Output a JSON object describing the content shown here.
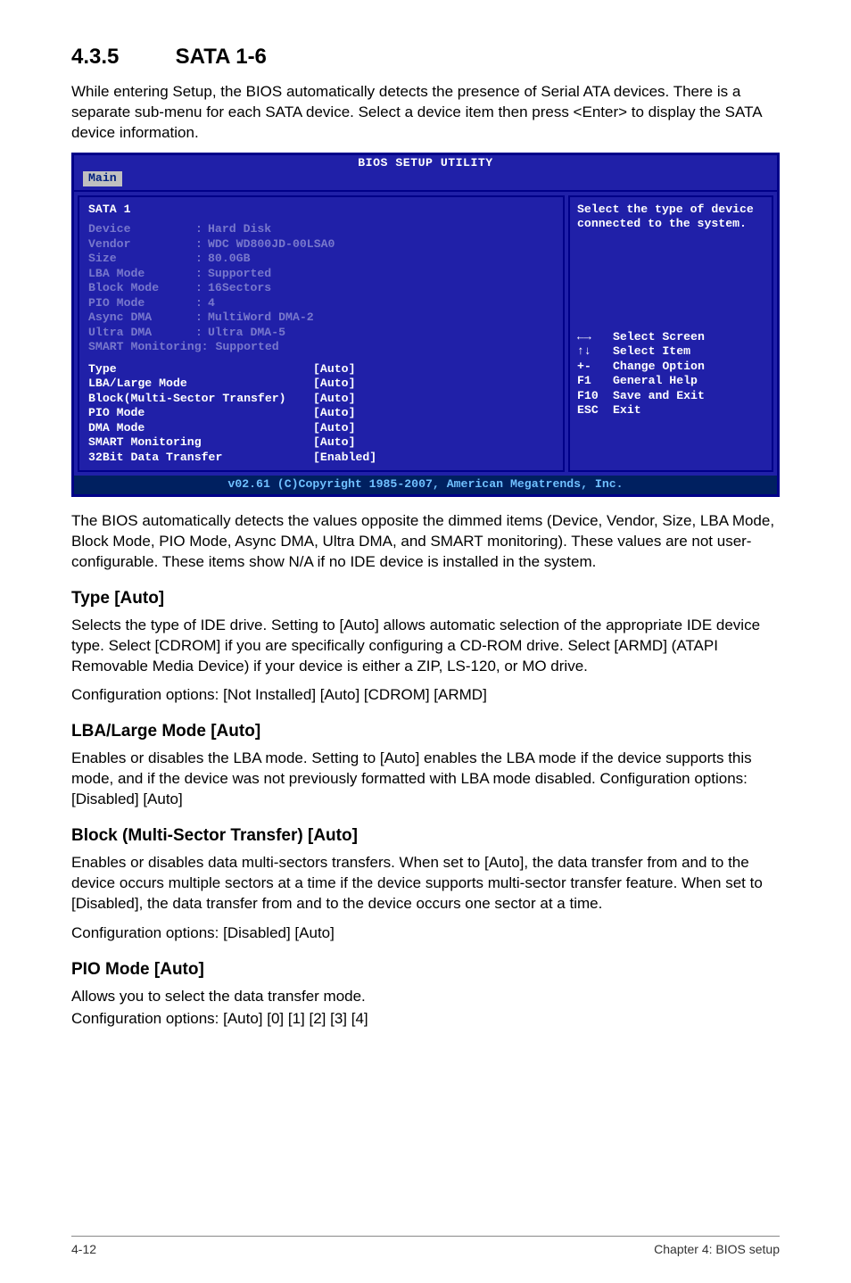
{
  "section": {
    "number": "4.3.5",
    "title": "SATA 1-6"
  },
  "intro": "While entering Setup, the BIOS automatically detects the presence of Serial ATA devices. There is a separate sub-menu for each SATA device. Select a device item then press <Enter> to display the SATA device information.",
  "bios": {
    "title": "BIOS SETUP UTILITY",
    "tab": "Main",
    "header": "SATA 1",
    "dim_rows": [
      {
        "label": "Device",
        "value": "Hard Disk"
      },
      {
        "label": "Vendor",
        "value": "WDC WD800JD-00LSA0"
      },
      {
        "label": "Size",
        "value": "80.0GB"
      },
      {
        "label": "LBA Mode",
        "value": "Supported"
      },
      {
        "label": "Block Mode",
        "value": "16Sectors"
      },
      {
        "label": "PIO Mode",
        "value": "4"
      },
      {
        "label": "Async DMA",
        "value": "MultiWord DMA-2"
      },
      {
        "label": "Ultra DMA",
        "value": "Ultra DMA-5"
      }
    ],
    "dim_last": "SMART Monitoring: Supported",
    "active_rows": [
      {
        "label": "Type",
        "value": "[Auto]"
      },
      {
        "label": "LBA/Large Mode",
        "value": "[Auto]"
      },
      {
        "label": "Block(Multi-Sector Transfer)",
        "value": "[Auto]"
      },
      {
        "label": "PIO Mode",
        "value": "[Auto]"
      },
      {
        "label": "DMA Mode",
        "value": "[Auto]"
      },
      {
        "label": "SMART Monitoring",
        "value": "[Auto]"
      },
      {
        "label": "32Bit Data Transfer",
        "value": "[Enabled]"
      }
    ],
    "help": "Select the type of device connected to the system.",
    "hints": [
      {
        "key": "←→",
        "text": "Select Screen"
      },
      {
        "key": "↑↓",
        "text": "Select Item"
      },
      {
        "key": "+-",
        "text": "Change Option"
      },
      {
        "key": "F1",
        "text": "General Help"
      },
      {
        "key": "F10",
        "text": "Save and Exit"
      },
      {
        "key": "ESC",
        "text": "Exit"
      }
    ],
    "copyright": "v02.61 (C)Copyright 1985-2007, American Megatrends, Inc."
  },
  "para_after_bios": "The BIOS automatically detects the values opposite the dimmed items (Device, Vendor, Size, LBA Mode, Block Mode, PIO Mode, Async DMA, Ultra DMA, and SMART monitoring). These values are not user-configurable. These items show N/A if no IDE device is installed in the system.",
  "type_head": "Type [Auto]",
  "type_body": "Selects the type of IDE drive. Setting to [Auto] allows automatic selection of the appropriate IDE device type. Select [CDROM] if you are specifically configuring a CD-ROM drive. Select [ARMD] (ATAPI Removable Media Device) if your device is either a ZIP, LS-120, or MO drive.",
  "type_opts": "Configuration options: [Not Installed] [Auto] [CDROM] [ARMD]",
  "lba_head": "LBA/Large Mode [Auto]",
  "lba_body": "Enables or disables the LBA mode. Setting to [Auto] enables the LBA mode if the device supports this mode, and if the device was not previously formatted with LBA mode disabled. Configuration options: [Disabled] [Auto]",
  "block_head": "Block (Multi-Sector Transfer) [Auto]",
  "block_body": "Enables or disables data multi-sectors transfers. When set to [Auto], the data transfer from and to the device occurs multiple sectors at a time if the device supports multi-sector transfer feature. When set to [Disabled], the data transfer from and to the device occurs one sector at a time.",
  "block_opts": "Configuration options: [Disabled] [Auto]",
  "pio_head": "PIO Mode [Auto]",
  "pio_body": "Allows you to select the data transfer mode.",
  "pio_opts": "Configuration options: [Auto] [0] [1] [2] [3] [4]",
  "footer_left": "4-12",
  "footer_right": "Chapter 4: BIOS setup"
}
